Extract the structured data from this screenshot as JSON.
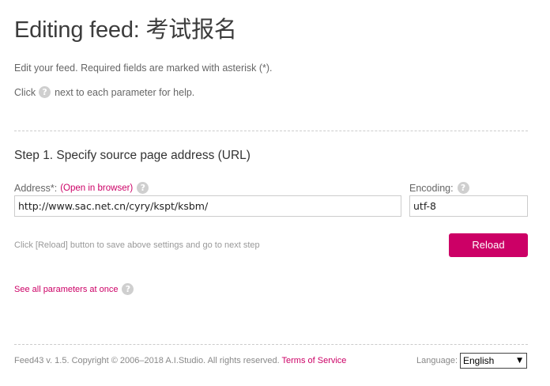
{
  "page": {
    "title": "Editing feed: 考试报名",
    "intro_line1": "Edit your feed. Required fields are marked with asterisk (*).",
    "intro_click": "Click",
    "intro_after": "next to each parameter for help.",
    "help_glyph": "?"
  },
  "step1": {
    "heading": "Step 1. Specify source page address (URL)",
    "address_label": "Address*:",
    "open_paren": "(",
    "open_link": "Open in browser",
    "close_paren": ")",
    "address_value": "http://www.sac.net.cn/cyry/kspt/ksbm/",
    "encoding_label": "Encoding:",
    "encoding_value": "utf-8",
    "hint": "Click [Reload] button to save above settings and go to next step",
    "reload_label": "Reload"
  },
  "see_all": {
    "label": "See all parameters at once"
  },
  "footer": {
    "copyright": "Feed43 v. 1.5. Copyright © 2006–2018 A.I.Studio. All rights reserved.",
    "terms_label": "Terms of Service",
    "language_label": "Language:",
    "language_value": "English"
  },
  "colors": {
    "accent": "#cc0066",
    "help_bg": "#cfcfcf",
    "divider": "#cccccc"
  },
  "icons": {
    "help": "help-icon",
    "dropdown": "chevron-down-icon"
  }
}
